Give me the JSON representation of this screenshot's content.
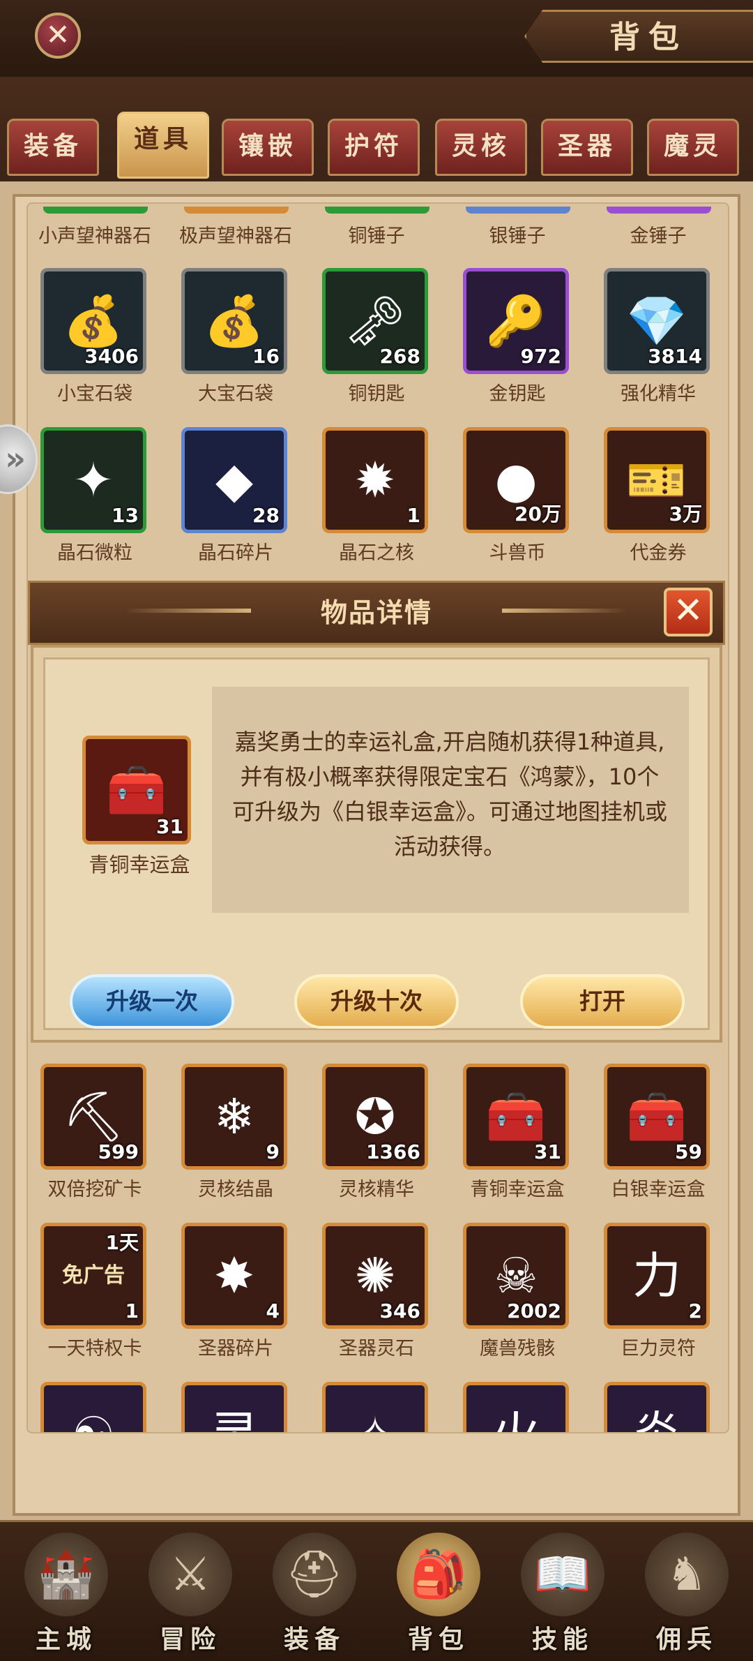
{
  "header": {
    "title": "背包",
    "close_icon": "close-icon"
  },
  "tabs": [
    {
      "label": "装备",
      "active": false
    },
    {
      "label": "道具",
      "active": true
    },
    {
      "label": "镶嵌",
      "active": false
    },
    {
      "label": "护符",
      "active": false
    },
    {
      "label": "灵核",
      "active": false
    },
    {
      "label": "圣器",
      "active": false
    },
    {
      "label": "魔灵",
      "active": false
    }
  ],
  "top_partial_row": [
    "小声望神器石",
    "极声望神器石",
    "铜锤子",
    "银锤子",
    "金锤子"
  ],
  "rows_above": [
    [
      {
        "name": "小宝石袋",
        "count": "3406",
        "icon": "gem-bag-icon",
        "frame": "grey",
        "glyph": "💰"
      },
      {
        "name": "大宝石袋",
        "count": "16",
        "icon": "gem-bag-icon",
        "frame": "grey",
        "glyph": "💰"
      },
      {
        "name": "铜钥匙",
        "count": "268",
        "icon": "key-icon",
        "frame": "green",
        "glyph": "🗝"
      },
      {
        "name": "金钥匙",
        "count": "972",
        "icon": "key-icon",
        "frame": "purple",
        "glyph": "🔑"
      },
      {
        "name": "强化精华",
        "count": "3814",
        "icon": "gem-icon",
        "frame": "grey",
        "glyph": "💎"
      }
    ],
    [
      {
        "name": "晶石微粒",
        "count": "13",
        "icon": "crystal-icon",
        "frame": "green",
        "glyph": "✦"
      },
      {
        "name": "晶石碎片",
        "count": "28",
        "icon": "crystal-icon",
        "frame": "blue",
        "glyph": "◆"
      },
      {
        "name": "晶石之核",
        "count": "1",
        "icon": "crystal-core-icon",
        "frame": "orange",
        "glyph": "✹"
      },
      {
        "name": "斗兽币",
        "count": "20万",
        "icon": "coin-icon",
        "frame": "orange",
        "glyph": "●"
      },
      {
        "name": "代金券",
        "count": "3万",
        "icon": "voucher-icon",
        "frame": "orange",
        "glyph": "🎫"
      }
    ]
  ],
  "dialog": {
    "title": "物品详情",
    "item_name": "青铜幸运盒",
    "item_count": "31",
    "description": "嘉奖勇士的幸运礼盒,开启随机获得1种道具,并有极小概率获得限定宝石《鸿蒙》，10个可升级为《白银幸运盒》。可通过地图挂机或活动获得。",
    "btn_upgrade_once": "升级一次",
    "btn_upgrade_ten": "升级十次",
    "btn_open": "打开"
  },
  "rows_below": [
    [
      {
        "name": "双倍挖矿卡",
        "count": "599",
        "icon": "mining-card-icon",
        "frame": "orange",
        "glyph": "⛏"
      },
      {
        "name": "灵核结晶",
        "count": "9",
        "icon": "crystal-icon",
        "frame": "orange",
        "glyph": "❄"
      },
      {
        "name": "灵核精华",
        "count": "1366",
        "icon": "essence-icon",
        "frame": "orange",
        "glyph": "✪"
      },
      {
        "name": "青铜幸运盒",
        "count": "31",
        "icon": "chest-icon",
        "frame": "orange",
        "glyph": "🧰"
      },
      {
        "name": "白银幸运盒",
        "count": "59",
        "icon": "chest-icon",
        "frame": "orange",
        "glyph": "🧰"
      }
    ],
    [
      {
        "name": "一天特权卡",
        "count": "1",
        "icon": "ad-free-card-icon",
        "frame": "orange",
        "glyph": "免广告",
        "tag": "1天"
      },
      {
        "name": "圣器碎片",
        "count": "4",
        "icon": "relic-shard-icon",
        "frame": "orange",
        "glyph": "✸"
      },
      {
        "name": "圣器灵石",
        "count": "346",
        "icon": "relic-stone-icon",
        "frame": "orange",
        "glyph": "✺"
      },
      {
        "name": "魔兽残骸",
        "count": "2002",
        "icon": "beast-remains-icon",
        "frame": "orange",
        "glyph": "☠"
      },
      {
        "name": "巨力灵符",
        "count": "2",
        "icon": "rune-icon",
        "frame": "orange",
        "glyph": "力"
      }
    ]
  ],
  "bottom_partial_row": [
    {
      "icon": "rune-icon",
      "glyph": "☯"
    },
    {
      "icon": "rune-icon",
      "glyph": "灵"
    },
    {
      "icon": "rune-icon",
      "glyph": "✧"
    },
    {
      "icon": "rune-icon",
      "glyph": "火"
    },
    {
      "icon": "rune-icon",
      "glyph": "炎"
    }
  ],
  "bottom_nav": [
    {
      "label": "主城",
      "icon": "castle-icon",
      "glyph": "🏰"
    },
    {
      "label": "冒险",
      "icon": "swords-icon",
      "glyph": "⚔"
    },
    {
      "label": "装备",
      "icon": "helmet-icon",
      "glyph": "⛑"
    },
    {
      "label": "背包",
      "icon": "backpack-icon",
      "glyph": "🎒",
      "active": true
    },
    {
      "label": "技能",
      "icon": "skill-book-icon",
      "glyph": "📖"
    },
    {
      "label": "佣兵",
      "icon": "mercenary-icon",
      "glyph": "♞"
    }
  ]
}
